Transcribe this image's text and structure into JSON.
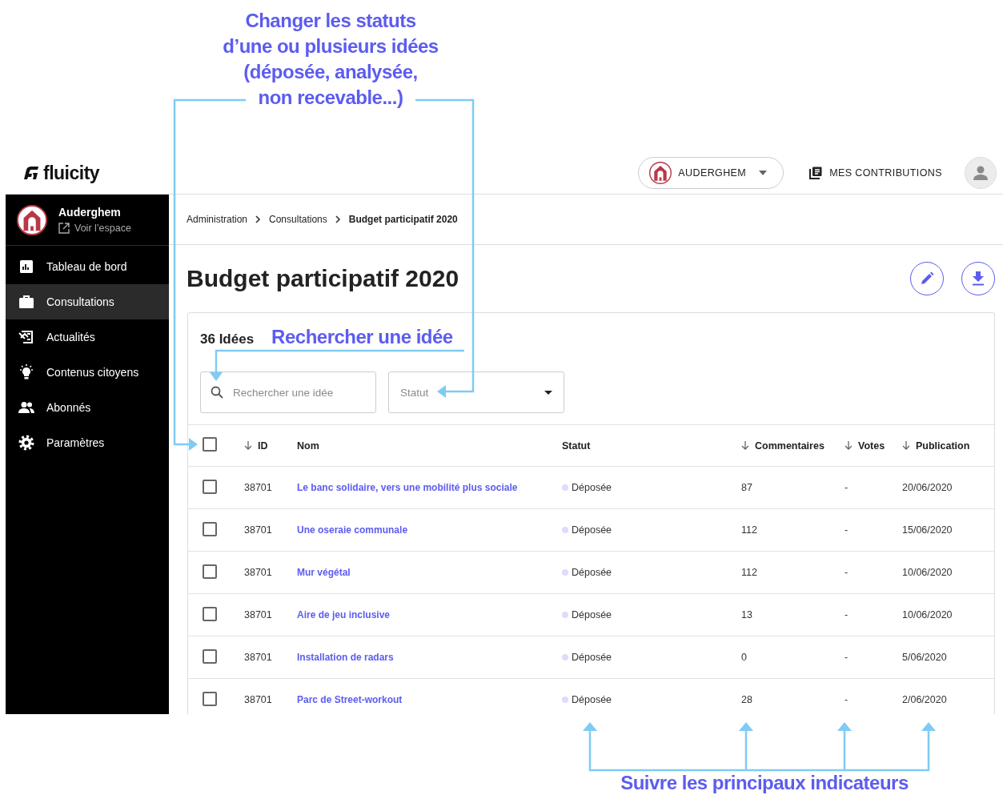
{
  "callouts": {
    "status_note": [
      "Changer les statuts",
      "d’une ou plusieurs idées",
      "(déposée, analysée,",
      "non recevable...)"
    ],
    "search_note": "Rechercher une idée",
    "indicators_note": "Suivre les principaux indicateurs"
  },
  "header": {
    "logo": "fluicity",
    "space_selector": "AUDERGHEM",
    "contributions": "MES CONTRIBUTIONS"
  },
  "sidebar": {
    "space_name": "Auderghem",
    "view_link": "Voir l’espace",
    "items": [
      {
        "label": "Tableau de bord",
        "kind": "dashboard",
        "selected": false
      },
      {
        "label": "Consultations",
        "kind": "briefcase",
        "selected": true
      },
      {
        "label": "Actualités",
        "kind": "news",
        "selected": false
      },
      {
        "label": "Contenus citoyens",
        "kind": "idea",
        "selected": false
      },
      {
        "label": "Abonnés",
        "kind": "people",
        "selected": false
      },
      {
        "label": "Paramètres",
        "kind": "settings",
        "selected": false
      }
    ]
  },
  "breadcrumb": [
    {
      "label": "Administration",
      "current": false
    },
    {
      "label": "Consultations",
      "current": false
    },
    {
      "label": "Budget participatif 2020",
      "current": true
    }
  ],
  "page": {
    "title": "Budget participatif 2020",
    "count": "36 Idées",
    "search": {
      "placeholder": "Rechercher une idée"
    },
    "status_filter": {
      "placeholder": "Statut"
    }
  },
  "table": {
    "select_all": {
      "checked": false
    },
    "columns": [
      {
        "label": "ID",
        "sortable": true
      },
      {
        "label": "Nom",
        "sortable": false
      },
      {
        "label": "Statut",
        "sortable": false
      },
      {
        "label": "Commentaires",
        "sortable": true
      },
      {
        "label": "Votes",
        "sortable": true
      },
      {
        "label": "Publication",
        "sortable": true
      }
    ],
    "rows": [
      {
        "checked": false,
        "id": "38701",
        "name": "Le banc solidaire, vers une mobilité plus sociale",
        "status": "Déposée",
        "color": "#dddcfb",
        "comments": "87",
        "votes": "-",
        "published": "20/06/2020"
      },
      {
        "checked": false,
        "id": "38701",
        "name": "Une oseraie communale",
        "status": "Déposée",
        "color": "#dddcfb",
        "comments": "112",
        "votes": "-",
        "published": "15/06/2020"
      },
      {
        "checked": false,
        "id": "38701",
        "name": "Mur végétal",
        "status": "Déposée",
        "color": "#dddcfb",
        "comments": "112",
        "votes": "-",
        "published": "10/06/2020"
      },
      {
        "checked": false,
        "id": "38701",
        "name": "Aire de jeu inclusive",
        "status": "Déposée",
        "color": "#dddcfb",
        "comments": "13",
        "votes": "-",
        "published": "10/06/2020"
      },
      {
        "checked": false,
        "id": "38701",
        "name": "Installation de radars",
        "status": "Déposée",
        "color": "#dddcfb",
        "comments": "0",
        "votes": "-",
        "published": "5/06/2020"
      },
      {
        "checked": false,
        "id": "38701",
        "name": "Parc de Street-workout",
        "status": "Déposée",
        "color": "#dddcfb",
        "comments": "28",
        "votes": "-",
        "published": "2/06/2020"
      }
    ]
  }
}
